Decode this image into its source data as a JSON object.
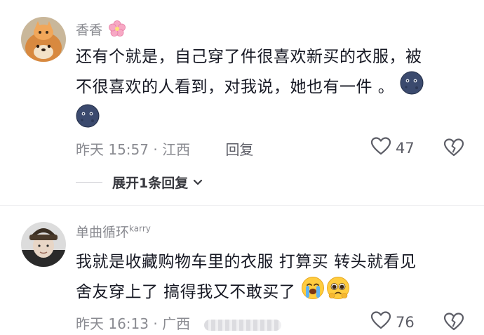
{
  "comments": [
    {
      "username": "香香",
      "text_line1": "还有个就是，自己穿了件很喜欢新买的衣服，被",
      "text_line2": "不很喜欢的人看到，对我说，她也有一件 。",
      "timestamp": "昨天 15:57 · 江西",
      "reply_label": "回复",
      "likes": "47",
      "expand_label": "展开1条回复"
    },
    {
      "username": "单曲循环",
      "username_sup": "karry",
      "text_line1": "我就是收藏购物车里的衣服 打算买 转头就看见",
      "text_line2": "舍友穿上了 搞得我又不敢买了",
      "timestamp": "昨天 16:13 · 广西",
      "likes": "76"
    }
  ],
  "icons": {
    "username_emoji": "cherry-blossom-icon",
    "moon_emoji": "new-moon-face-icon",
    "crying_emoji": "loudly-crying-face-icon",
    "pleading_emoji": "pleading-face-icon",
    "like": "heart-outline-icon",
    "dislike": "broken-heart-icon",
    "expand": "chevron-down-icon"
  }
}
